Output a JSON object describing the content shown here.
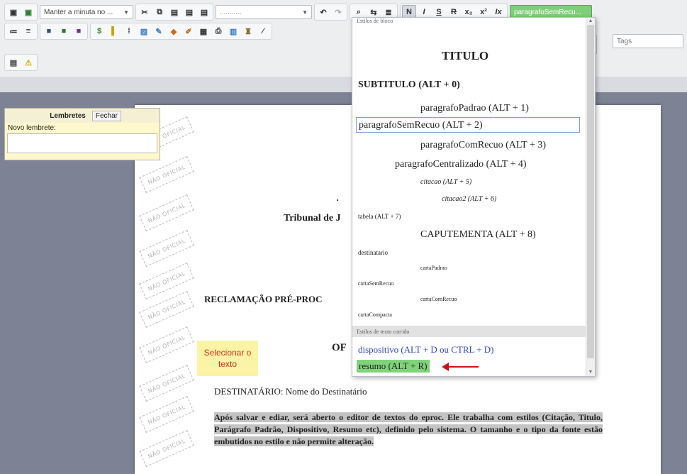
{
  "toolbar": {
    "template_select": "Manter a minuta no ...",
    "font_select": "...........",
    "style_select": "paragrafoSemRecu...",
    "tags_placeholder": "Tags",
    "format_buttons": [
      "N",
      "I",
      "S",
      "R",
      "x₂",
      "x²",
      "Ix"
    ]
  },
  "reminders": {
    "title": "Lembretes",
    "close_label": "Fechar",
    "new_label": "Novo lembrete:"
  },
  "stamp_text": "NÃO OFICIAL",
  "document": {
    "court": "Tribunal de J",
    "claim_heading": "RECLAMAÇÃO PRÉ-PROC",
    "of_heading": "OF",
    "recipient": "DESTINATÁRIO: Nome do Destinatário",
    "body": "Após salvar e ediar, será aberto o editor de textos do eproc. Ele trabalha com estilos (Citação, Titulo, Parágrafo Padrão, Dispositivo, Resumo etc), definido pelo sistema. O tamanho e o tipo da fonte estão embutidos no estilo e não permite alteração.",
    "stray_char": "·"
  },
  "hint": {
    "line1": "Selecionar o",
    "line2": "texto"
  },
  "style_menu": {
    "header": "Estilos de bloco",
    "items": [
      "TITULO",
      "SUBTITULO (ALT + 0)",
      "paragrafoPadrao (ALT + 1)",
      "paragrafoSemRecuo (ALT + 2)",
      "paragrafoComRecuo (ALT + 3)",
      "paragrafoCentralizado (ALT + 4)",
      "citacao (ALT + 5)",
      "citacao2 (ALT + 6)",
      "tabela (ALT + 7)",
      "CAPUTEMENTA (ALT + 8)",
      "destinatario",
      "cartaPadrao",
      "cartaSemRecuo",
      "cartaComRecuo",
      "cartaCompacta"
    ],
    "section_label": "Estilos de texto corrido",
    "inline_items": [
      "dispositivo (ALT + D ou CTRL + D)",
      "resumo (ALT + R)"
    ],
    "colors": {
      "selected_border": "#7f9fd8",
      "highlight": "#7fd47a",
      "link": "#3147c8",
      "arrow": "#c6141b"
    }
  }
}
